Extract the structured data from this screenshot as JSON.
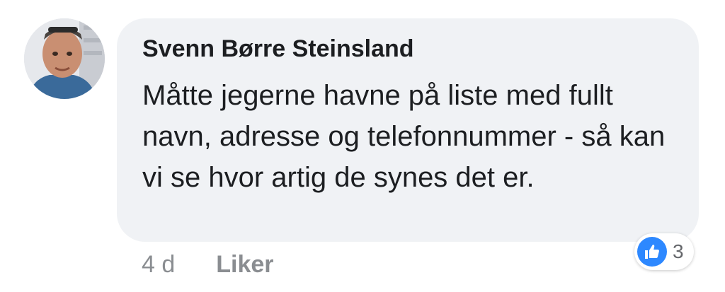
{
  "comment": {
    "author": "Svenn Børre Steinsland",
    "text": "Måtte jegerne havne på liste med fullt navn, adresse og telefonnummer - så kan vi se hvor artig de synes det er.",
    "timestamp": "4 d",
    "like_label": "Liker",
    "reaction_count": "3",
    "reaction_icon": "thumbs-up-icon"
  },
  "colors": {
    "bubble": "#f0f2f5",
    "text": "#1c1e21",
    "meta": "#8a8d91",
    "like_blue": "#2d88ff"
  }
}
